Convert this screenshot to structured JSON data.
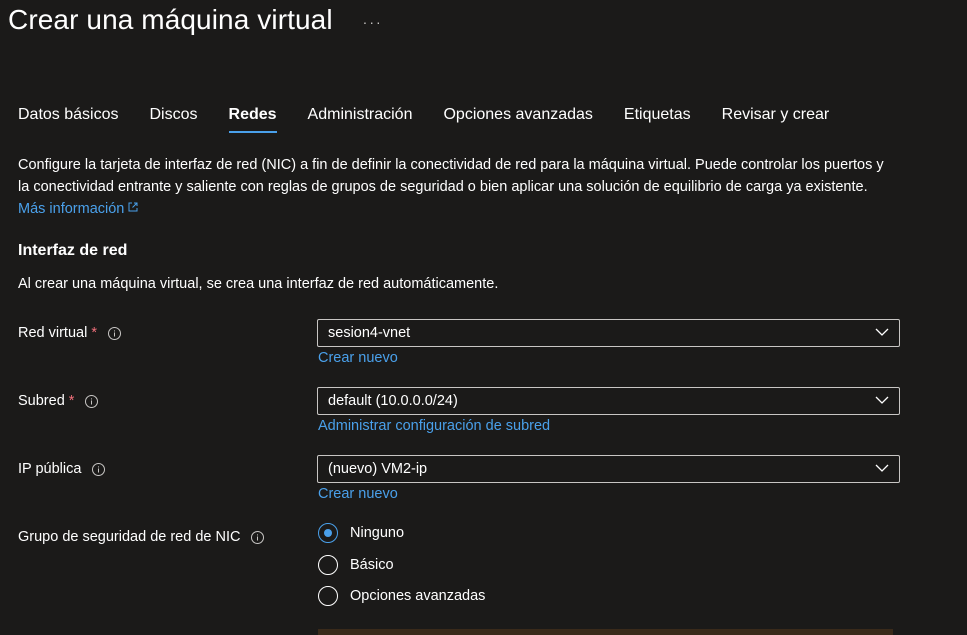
{
  "header": {
    "title": "Crear una máquina virtual",
    "more_label": "···"
  },
  "tabs": [
    {
      "label": "Datos básicos",
      "active": false
    },
    {
      "label": "Discos",
      "active": false
    },
    {
      "label": "Redes",
      "active": true
    },
    {
      "label": "Administración",
      "active": false
    },
    {
      "label": "Opciones avanzadas",
      "active": false
    },
    {
      "label": "Etiquetas",
      "active": false
    },
    {
      "label": "Revisar y crear",
      "active": false
    }
  ],
  "intro": {
    "text": "Configure la tarjeta de interfaz de red (NIC) a fin de definir la conectividad de red para la máquina virtual. Puede controlar los puertos y la conectividad entrante y saliente con reglas de grupos de seguridad o bien aplicar una solución de equilibrio de carga ya existente.",
    "link": "Más información"
  },
  "section": {
    "title": "Interfaz de red",
    "description": "Al crear una máquina virtual, se crea una interfaz de red automáticamente."
  },
  "fields": {
    "vnet": {
      "label": "Red virtual",
      "required": "*",
      "value": "sesion4-vnet",
      "link": "Crear nuevo"
    },
    "subnet": {
      "label": "Subred",
      "required": "*",
      "value": "default (10.0.0.0/24)",
      "link": "Administrar configuración de subred"
    },
    "public_ip": {
      "label": "IP pública",
      "value": "(nuevo) VM2-ip",
      "link": "Crear nuevo"
    },
    "nsg": {
      "label": "Grupo de seguridad de red de NIC",
      "options": [
        {
          "label": "Ninguno",
          "selected": true
        },
        {
          "label": "Básico",
          "selected": false
        },
        {
          "label": "Opciones avanzadas",
          "selected": false
        }
      ]
    }
  },
  "colors": {
    "background": "#1b1a19",
    "accent": "#4aa0ea",
    "required": "#f1707b",
    "border": "#c8c6c4"
  }
}
